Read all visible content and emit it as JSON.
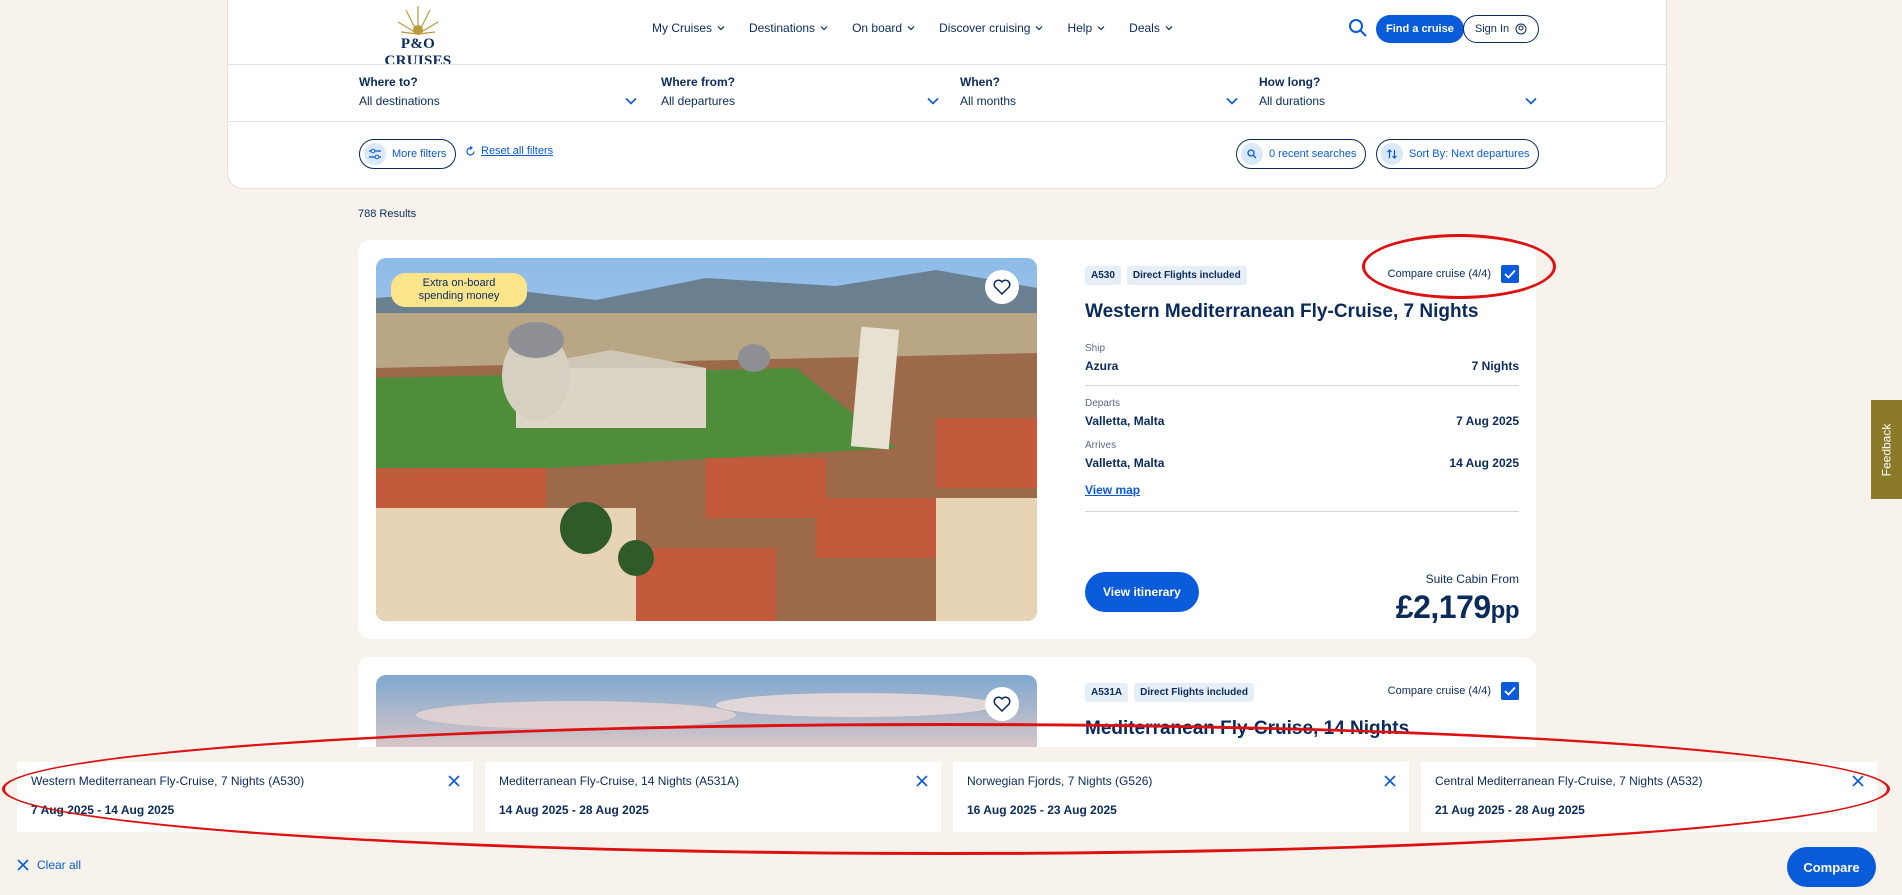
{
  "brand": {
    "logo_text": "P&O CRUISES"
  },
  "nav": {
    "items": [
      "My Cruises",
      "Destinations",
      "On board",
      "Discover cruising",
      "Help",
      "Deals"
    ],
    "find_label": "Find a cruise",
    "signin_label": "Sign In"
  },
  "filters": [
    {
      "label": "Where to?",
      "value": "All destinations"
    },
    {
      "label": "Where from?",
      "value": "All departures"
    },
    {
      "label": "When?",
      "value": "All months"
    },
    {
      "label": "How long?",
      "value": "All durations"
    }
  ],
  "actions": {
    "more_filters": "More filters",
    "reset": "Reset all filters",
    "recent": "0 recent searches",
    "sort": "Sort By: Next departures"
  },
  "results_count": "788 Results",
  "cards": [
    {
      "ribbon": "Extra on-board spending money",
      "code": "A530",
      "flights": "Direct Flights included",
      "compare_label": "Compare cruise (4/4)",
      "compare_checked": true,
      "title": "Western Mediterranean Fly-Cruise, 7 Nights",
      "ship_label": "Ship",
      "ship": "Azura",
      "nights": "7 Nights",
      "departs_label": "Departs",
      "departs_port": "Valletta, Malta",
      "departs_date": "7 Aug 2025",
      "arrives_label": "Arrives",
      "arrives_port": "Valletta, Malta",
      "arrives_date": "14 Aug 2025",
      "view_map": "View map",
      "itinerary_label": "View itinerary",
      "price_label": "Suite Cabin From",
      "price": "£2,179",
      "price_unit": "pp"
    },
    {
      "code": "A531A",
      "flights": "Direct Flights included",
      "compare_label": "Compare cruise (4/4)",
      "compare_checked": true,
      "title": "Mediterranean Fly-Cruise, 14 Nights"
    }
  ],
  "feedback_label": "Feedback",
  "compare_tray": {
    "items": [
      {
        "title": "Western Mediterranean Fly-Cruise, 7 Nights (A530)",
        "dates": "7 Aug 2025 - 14 Aug 2025"
      },
      {
        "title": "Mediterranean Fly-Cruise, 14 Nights (A531A)",
        "dates": "14 Aug 2025 - 28 Aug 2025"
      },
      {
        "title": "Norwegian Fjords, 7 Nights (G526)",
        "dates": "16 Aug 2025 - 23 Aug 2025"
      },
      {
        "title": "Central Mediterranean Fly-Cruise, 7 Nights (A532)",
        "dates": "21 Aug 2025 - 28 Aug 2025"
      }
    ],
    "clear_label": "Clear all",
    "compare_label": "Compare"
  },
  "colors": {
    "primary": "#0a5bd9",
    "navy": "#0a2a5c",
    "background": "#f7f3ec",
    "ribbon": "#fbe48a",
    "annotation": "#dd1111"
  }
}
